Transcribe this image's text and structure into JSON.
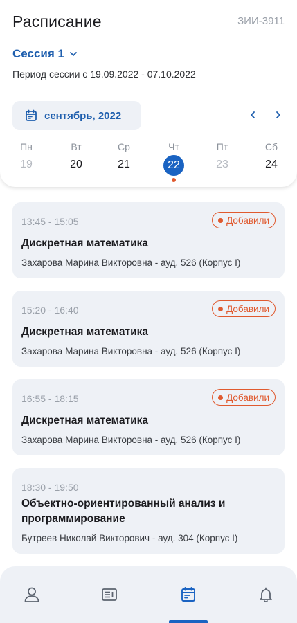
{
  "header": {
    "title": "Расписание",
    "group_code": "ЗИИ-3911",
    "session_label": "Сессия 1",
    "period": "Период сессии с 19.09.2022 - 07.10.2022"
  },
  "calendar": {
    "month_label": "сентябрь, 2022",
    "days": [
      {
        "name": "Пн",
        "num": "19",
        "state": "muted"
      },
      {
        "name": "Вт",
        "num": "20",
        "state": "normal"
      },
      {
        "name": "Ср",
        "num": "21",
        "state": "normal"
      },
      {
        "name": "Чт",
        "num": "22",
        "state": "selected"
      },
      {
        "name": "Пт",
        "num": "23",
        "state": "muted"
      },
      {
        "name": "Сб",
        "num": "24",
        "state": "normal"
      }
    ]
  },
  "lessons": [
    {
      "time": "13:45 - 15:05",
      "badge": "Добавили",
      "subject": "Дискретная математика",
      "teacher": "Захарова Марина Викторовна - ауд. 526 (Корпус I)"
    },
    {
      "time": "15:20 - 16:40",
      "badge": "Добавили",
      "subject": "Дискретная математика",
      "teacher": "Захарова Марина Викторовна - ауд. 526 (Корпус I)"
    },
    {
      "time": "16:55 - 18:15",
      "badge": "Добавили",
      "subject": "Дискретная математика",
      "teacher": "Захарова Марина Викторовна - ауд. 526 (Корпус I)"
    },
    {
      "time": "18:30 - 19:50",
      "badge": "",
      "subject": "Объектно-ориентированный анализ и программирование",
      "teacher": "Бутреев Николай Викторович - ауд. 304 (Корпус I)"
    }
  ],
  "bottom_nav": {
    "items": [
      "profile-icon",
      "news-icon",
      "schedule-icon",
      "notifications-icon"
    ],
    "active": "schedule-icon"
  },
  "colors": {
    "accent": "#1a63c2",
    "badge": "#e05a2f",
    "card_bg": "#eef1f6"
  }
}
